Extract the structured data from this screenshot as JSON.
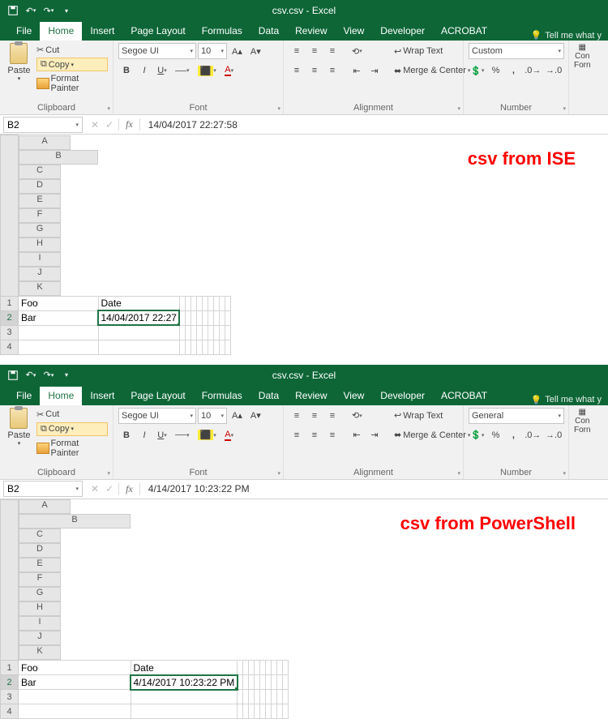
{
  "windows": [
    {
      "title": "csv.csv - Excel",
      "tabs": [
        "File",
        "Home",
        "Insert",
        "Page Layout",
        "Formulas",
        "Data",
        "Review",
        "View",
        "Developer",
        "ACROBAT"
      ],
      "activeTab": "Home",
      "tellMe": "Tell me what y",
      "clipboard": {
        "cut": "Cut",
        "copy": "Copy",
        "fmt": "Format Painter",
        "paste": "Paste",
        "label": "Clipboard"
      },
      "font": {
        "name": "Segoe UI",
        "size": "10",
        "label": "Font",
        "bold": "B",
        "italic": "I",
        "underline": "U"
      },
      "alignment": {
        "wrap": "Wrap Text",
        "merge": "Merge & Center",
        "label": "Alignment"
      },
      "number": {
        "format": "Custom",
        "label": "Number",
        "pct": "%",
        "comma": ","
      },
      "cells": {
        "cond": "Con",
        "form": "Forn"
      },
      "namebox": "B2",
      "formula": "14/04/2017  22:27:58",
      "columns": [
        "A",
        "B",
        "C",
        "D",
        "E",
        "F",
        "G",
        "H",
        "I",
        "J",
        "K"
      ],
      "rows": [
        {
          "n": "1",
          "A": "Foo",
          "B": "Date"
        },
        {
          "n": "2",
          "A": "Bar",
          "B": "14/04/2017 22:27"
        },
        {
          "n": "3",
          "A": "",
          "B": ""
        },
        {
          "n": "4",
          "A": "",
          "B": ""
        }
      ],
      "colBWidth": 98,
      "annotation": "csv from\nISE"
    },
    {
      "title": "csv.csv - Excel",
      "tabs": [
        "File",
        "Home",
        "Insert",
        "Page Layout",
        "Formulas",
        "Data",
        "Review",
        "View",
        "Developer",
        "ACROBAT"
      ],
      "activeTab": "Home",
      "tellMe": "Tell me what y",
      "clipboard": {
        "cut": "Cut",
        "copy": "Copy",
        "fmt": "Format Painter",
        "paste": "Paste",
        "label": "Clipboard"
      },
      "font": {
        "name": "Segoe UI",
        "size": "10",
        "label": "Font",
        "bold": "B",
        "italic": "I",
        "underline": "U"
      },
      "alignment": {
        "wrap": "Wrap Text",
        "merge": "Merge & Center",
        "label": "Alignment"
      },
      "number": {
        "format": "General",
        "label": "Number",
        "pct": "%",
        "comma": ","
      },
      "cells": {
        "cond": "Con",
        "form": "Forn"
      },
      "namebox": "B2",
      "formula": "4/14/2017 10:23:22 PM",
      "columns": [
        "A",
        "B",
        "C",
        "D",
        "E",
        "F",
        "G",
        "H",
        "I",
        "J",
        "K"
      ],
      "rows": [
        {
          "n": "1",
          "A": "Foo",
          "B": "Date"
        },
        {
          "n": "2",
          "A": "Bar",
          "B": "4/14/2017 10:23:22 PM"
        },
        {
          "n": "3",
          "A": "",
          "B": ""
        },
        {
          "n": "4",
          "A": "",
          "B": ""
        }
      ],
      "colBWidth": 138,
      "annotation": "csv from\nPowerShell"
    }
  ]
}
